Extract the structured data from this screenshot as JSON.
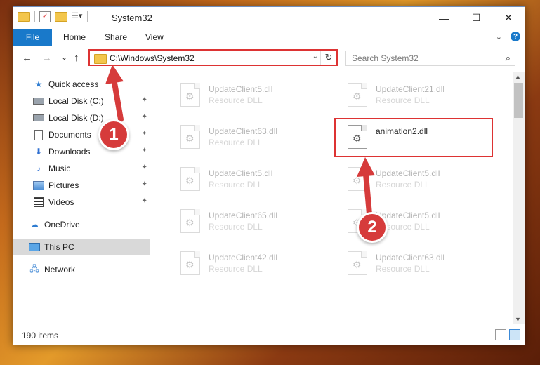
{
  "window": {
    "title": "System32",
    "controls": {
      "minimize": "—",
      "maximize": "☐",
      "close": "✕"
    }
  },
  "ribbon": {
    "tabs": [
      "File",
      "Home",
      "Share",
      "View"
    ],
    "expand_icon": "chevron-down-icon",
    "help": "?"
  },
  "nav": {
    "back": "←",
    "forward": "→",
    "recent": "⌄",
    "up": "↑"
  },
  "address": {
    "path": "C:\\Windows\\System32",
    "dropdown": "⌄",
    "refresh": "↻"
  },
  "search": {
    "placeholder": "Search System32",
    "icon": "⌕"
  },
  "sidebar": {
    "items": [
      {
        "label": "Quick access",
        "icon": "star-icon",
        "pinned": false
      },
      {
        "label": "Local Disk (C:)",
        "icon": "drive-icon",
        "pinned": true
      },
      {
        "label": "Local Disk (D:)",
        "icon": "drive-icon",
        "pinned": true
      },
      {
        "label": "Documents",
        "icon": "documents-icon",
        "pinned": true
      },
      {
        "label": "Downloads",
        "icon": "download-icon",
        "pinned": true
      },
      {
        "label": "Music",
        "icon": "music-icon",
        "pinned": true
      },
      {
        "label": "Pictures",
        "icon": "pictures-icon",
        "pinned": true
      },
      {
        "label": "Videos",
        "icon": "videos-icon",
        "pinned": true
      },
      {
        "label": "OneDrive",
        "icon": "cloud-icon",
        "pinned": false
      },
      {
        "label": "This PC",
        "icon": "computer-icon",
        "pinned": false,
        "selected": true
      },
      {
        "label": "Network",
        "icon": "network-icon",
        "pinned": false
      }
    ],
    "pin_glyph": "📌"
  },
  "files": [
    {
      "name": "UpdateClient5.dll",
      "desc": "Resource DLL",
      "faded": true
    },
    {
      "name": "UpdateClient21.dll",
      "desc": "Resource DLL",
      "faded": true
    },
    {
      "name": "UpdateClient63.dll",
      "desc": "Resource DLL",
      "faded": true
    },
    {
      "name": "animation2.dll",
      "desc": "",
      "faded": false,
      "highlighted": true
    },
    {
      "name": "UpdateClient5.dll",
      "desc": "Resource DLL",
      "faded": true
    },
    {
      "name": "UpdateClient5.dll",
      "desc": "Resource DLL",
      "faded": true
    },
    {
      "name": "UpdateClient65.dll",
      "desc": "Resource DLL",
      "faded": true
    },
    {
      "name": "UpdateClient5.dll",
      "desc": "Resource DLL",
      "faded": true
    },
    {
      "name": "UpdateClient42.dll",
      "desc": "Resource DLL",
      "faded": true
    },
    {
      "name": "UpdateClient63.dll",
      "desc": "Resource DLL",
      "faded": true
    }
  ],
  "status": {
    "count": "190 items"
  },
  "annotations": {
    "step1": "1",
    "step2": "2",
    "color": "#d63b3b"
  },
  "colors": {
    "accent": "#1979ca",
    "highlight_border": "#dd3333"
  }
}
